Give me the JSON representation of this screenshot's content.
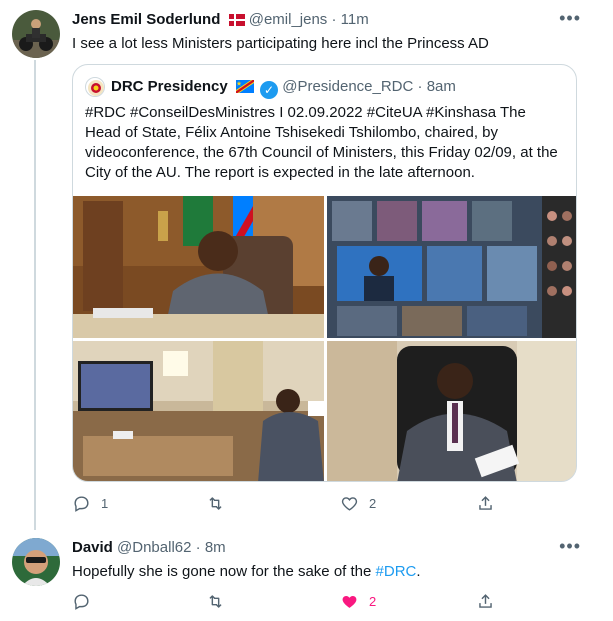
{
  "tweet1": {
    "name": "Jens Emil Soderlund",
    "handle": "@emil_jens",
    "time": "11m",
    "text": "I see a lot less Ministers participating here incl the Princess AD",
    "actions": {
      "replies": "1",
      "retweets": "",
      "likes": "2"
    },
    "icons": {
      "flag": "denmark-flag-icon",
      "more": "more-icon"
    }
  },
  "quote": {
    "name": "DRC Presidency",
    "handle": "@Presidence_RDC",
    "time": "8am",
    "text_tags": "#RDC #ConseilDesMinistres I 02.09.2022 #CiteUA #Kinshasa",
    "text_body": " The Head of State, Félix Antoine Tshisekedi Tshilombo, chaired, by videoconference, the 67th Council of Ministers, this Friday 02/09, at the City of the AU. The report is expected in the late afternoon.",
    "icons": {
      "flag": "drc-flag-icon",
      "verified": "verified-badge-icon"
    }
  },
  "tweet2": {
    "name": "David",
    "handle": "@Dnball62",
    "time": "8m",
    "text_prefix": "Hopefully she is gone now for the sake of the ",
    "hashtag": "#DRC",
    "text_suffix": ".",
    "actions": {
      "replies": "",
      "retweets": "",
      "likes": "2"
    }
  },
  "separator": "·",
  "colors": {
    "accent": "#1d9bf0",
    "like": "#f91880",
    "muted": "#536471"
  }
}
